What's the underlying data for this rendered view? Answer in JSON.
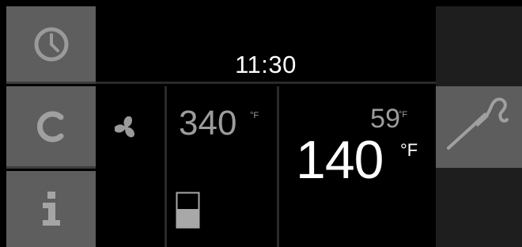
{
  "header": {
    "time": "11:30"
  },
  "left_menu": {
    "items": [
      {
        "icon": "clock-icon"
      },
      {
        "icon": "c-icon"
      },
      {
        "icon": "info-icon"
      }
    ]
  },
  "fan": {
    "icon": "fan-icon"
  },
  "oven": {
    "temperature": "340",
    "unit": "°F",
    "door_icon": "oven-door-icon"
  },
  "probe": {
    "set_temperature": "59",
    "set_unit": "°F",
    "current_temperature": "140",
    "current_unit": "°F",
    "icon": "meat-probe-icon"
  },
  "colors": {
    "background": "#000000",
    "button_gray": "#5e5e5e",
    "dim_text": "#9c9c9c",
    "bright_text": "#ffffff"
  }
}
